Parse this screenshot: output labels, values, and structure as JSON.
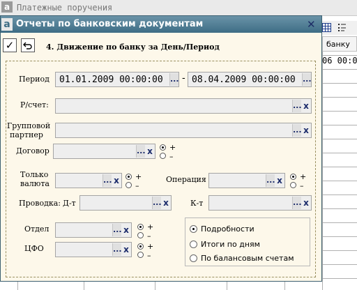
{
  "background_window": {
    "title": "Платежные поручения",
    "column_header": "банку",
    "cell_value": "06 00:00"
  },
  "dialog": {
    "title": "Отчеты по банковским документам",
    "report_title": "4. Движение по банку за День/Период"
  },
  "form": {
    "period_label": "Период",
    "period_from": "01.01.2009 00:00:00",
    "period_sep": "-",
    "period_to": "08.04.2009 00:00:00",
    "account_label": "Р/счет:",
    "group_partner_label_line1": "Групповой",
    "group_partner_label_line2": "партнер",
    "contract_label": "Договор",
    "only_currency_line1": "Только",
    "only_currency_line2": "валюта",
    "operation_label": "Операция",
    "posting_label": "Проводка:",
    "debit_label": "Д-т",
    "credit_label": "К-т",
    "department_label": "Отдел",
    "cfo_label": "ЦФО",
    "plus": "+",
    "minus": "–",
    "dots": "...",
    "clear": "x"
  },
  "options": {
    "items": [
      {
        "label": "Подробности",
        "selected": true
      },
      {
        "label": "Итоги по дням",
        "selected": false
      },
      {
        "label": "По балансовым счетам",
        "selected": false
      }
    ]
  },
  "icons": {
    "ok": "check-icon",
    "undo": "undo-icon",
    "close": "close-icon",
    "app": "app-logo-icon"
  },
  "colors": {
    "title_bar": "#4a7890",
    "dialog_bg": "#fdf8ea",
    "field_bg": "#eeeeee",
    "accent": "#1a2a6a"
  }
}
